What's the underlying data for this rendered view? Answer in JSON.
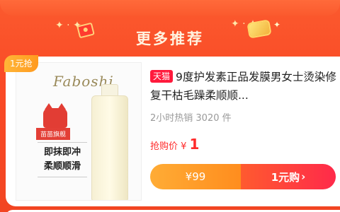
{
  "colors": {
    "accent": "#fa4a26",
    "price": "#ff2b2b",
    "tmall": "#ff1a3c",
    "orange_button": "#ff9a1f"
  },
  "header": {
    "title": "更多推荐"
  },
  "product": {
    "corner_badge": "1元抢",
    "brand": "Faboshi",
    "platform_tag": "天猫",
    "title": "9度护发素正品发膜男女士烫染修复干枯毛躁柔顺顺...",
    "sales": "2小时热销 3020 件",
    "promo_label": "抢购价 ¥",
    "promo_price": "1",
    "image_tag": "苗苗旗舰",
    "image_slogan_line1": "即抹即冲",
    "image_slogan_line2": "柔顺顺滑"
  },
  "buy_bar": {
    "original_price": "¥99",
    "action_label": "1元购",
    "action_icon": "chevron-right-icon"
  }
}
